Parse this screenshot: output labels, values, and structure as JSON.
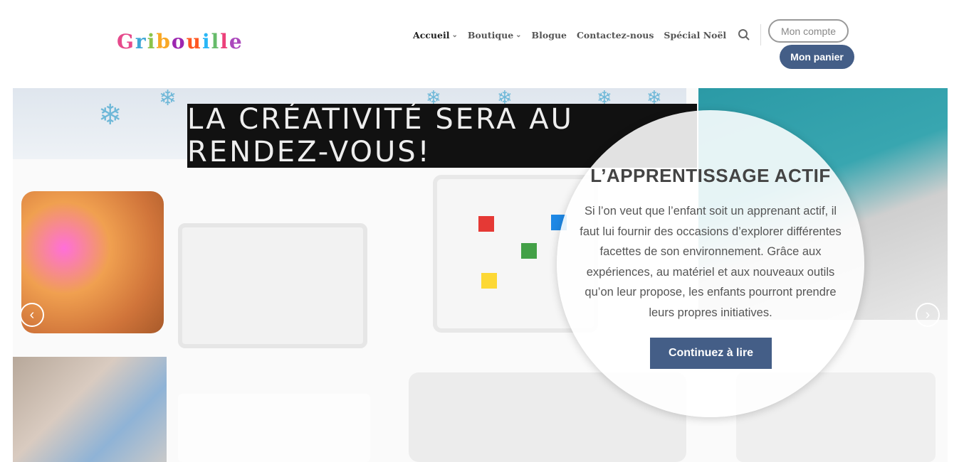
{
  "brand": {
    "logo_text": "Gribouille",
    "logo_colors": [
      "#e64a8c",
      "#3fa7d6",
      "#8bc34a",
      "#f9a825",
      "#9c27b0",
      "#ff5722",
      "#29b6f6",
      "#66bb6a",
      "#ec407a",
      "#ab47bc"
    ]
  },
  "nav": {
    "items": [
      {
        "label": "Accueil",
        "has_dropdown": true,
        "active": true
      },
      {
        "label": "Boutique",
        "has_dropdown": true,
        "active": false
      },
      {
        "label": "Blogue",
        "has_dropdown": false,
        "active": false
      },
      {
        "label": "Contactez-nous",
        "has_dropdown": false,
        "active": false
      },
      {
        "label": "Spécial Noël",
        "has_dropdown": false,
        "active": false
      }
    ],
    "search_icon": "search-icon",
    "account_label": "Mon compte",
    "cart_label": "Mon panier"
  },
  "slide": {
    "banner_text": "LA CRÉATIVITÉ SERA AU RENDEZ-VOUS!",
    "title": "L’APPRENTISSAGE ACTIF",
    "text": "Si l’on veut que l’enfant soit un apprenant actif, il faut lui fournir des occasions d’explorer différentes facettes de son environnement. Grâce aux expériences, au matériel et aux nouveaux outils qu’on leur propose, les enfants pourront prendre leurs propres initiatives.",
    "button_label": "Continuez à lire",
    "prev_icon": "chevron-left-icon",
    "next_icon": "chevron-right-icon"
  },
  "colors": {
    "accent": "#445e87",
    "text": "#555555"
  }
}
